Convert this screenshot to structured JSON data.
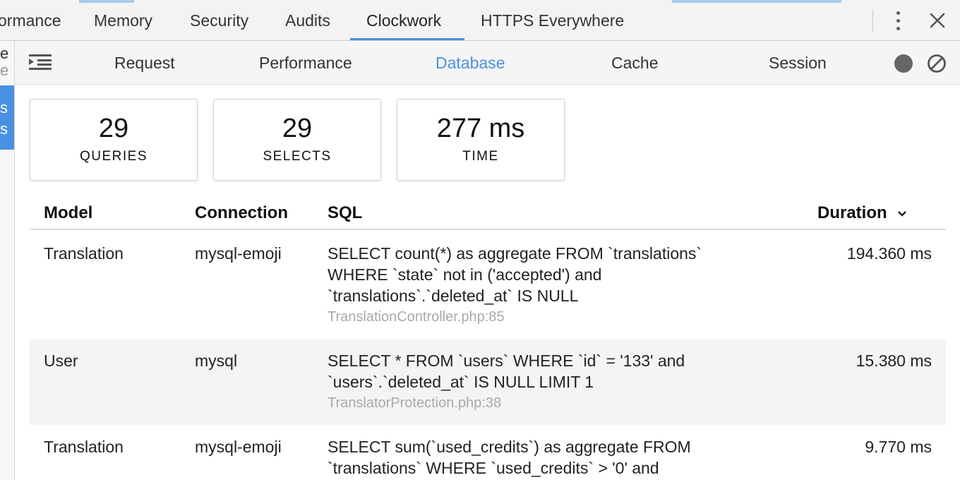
{
  "devtools": {
    "tabs": [
      {
        "label": "ormance"
      },
      {
        "label": "Memory"
      },
      {
        "label": "Security"
      },
      {
        "label": "Audits"
      },
      {
        "label": "Clockwork"
      },
      {
        "label": "HTTPS Everywhere"
      }
    ],
    "active_tab": "Clockwork",
    "accent_color": "#4a90e2"
  },
  "sidebar": {
    "top_line1": "e",
    "top_line2": "e",
    "selected_line1": "s",
    "selected_line2": "s"
  },
  "clockwork_nav": {
    "tabs": [
      {
        "label": "Request"
      },
      {
        "label": "Performance"
      },
      {
        "label": "Database"
      },
      {
        "label": "Cache"
      },
      {
        "label": "Session"
      }
    ],
    "active_tab": "Database"
  },
  "summary": {
    "queries": {
      "value": "29",
      "label": "QUERIES"
    },
    "selects": {
      "value": "29",
      "label": "SELECTS"
    },
    "time": {
      "value": "277 ms",
      "label": "TIME"
    }
  },
  "table": {
    "headers": {
      "model": "Model",
      "connection": "Connection",
      "sql": "SQL",
      "duration": "Duration"
    },
    "rows": [
      {
        "model": "Translation",
        "connection": "mysql-emoji",
        "sql_lines": [
          "SELECT count(*) as aggregate FROM `translations`",
          "WHERE `state` not in ('accepted') and",
          "`translations`.`deleted_at` IS NULL"
        ],
        "file": "TranslationController.php:85",
        "duration": "194.360 ms"
      },
      {
        "model": "User",
        "connection": "mysql",
        "sql_lines": [
          "SELECT * FROM `users` WHERE `id` = '133' and",
          "`users`.`deleted_at` IS NULL LIMIT 1"
        ],
        "file": "TranslatorProtection.php:38",
        "duration": "15.380 ms"
      },
      {
        "model": "Translation",
        "connection": "mysql-emoji",
        "sql_lines": [
          "SELECT sum(`used_credits`) as aggregate FROM",
          "`translations` WHERE `used_credits` > '0' and"
        ],
        "file": "",
        "duration": "9.770 ms"
      }
    ]
  }
}
